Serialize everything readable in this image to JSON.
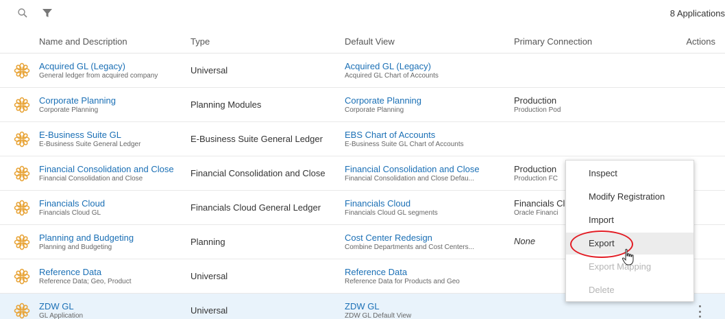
{
  "toolbar": {
    "app_count": "8 Applications",
    "icons": [
      "search-icon",
      "filter-icon"
    ]
  },
  "columns": {
    "name": "Name and Description",
    "type": "Type",
    "view": "Default View",
    "connection": "Primary Connection",
    "actions": "Actions"
  },
  "rows": [
    {
      "name": "Acquired GL (Legacy)",
      "desc": "General ledger from acquired company",
      "type": "Universal",
      "view": "Acquired GL (Legacy)",
      "view_desc": "Acquired GL Chart of Accounts",
      "conn": "",
      "conn_desc": ""
    },
    {
      "name": "Corporate Planning",
      "desc": "Corporate Planning",
      "type": "Planning Modules",
      "view": "Corporate Planning",
      "view_desc": "Corporate Planning",
      "conn": "Production",
      "conn_desc": "Production Pod"
    },
    {
      "name": "E-Business Suite GL",
      "desc": "E-Business Suite General Ledger",
      "type": "E-Business Suite General Ledger",
      "view": "EBS Chart of Accounts",
      "view_desc": "E-Business Suite GL Chart of Accounts",
      "conn": "",
      "conn_desc": ""
    },
    {
      "name": "Financial Consolidation and Close",
      "desc": "Financial Consolidation and Close",
      "type": "Financial Consolidation and Close",
      "view": "Financial Consolidation and Close",
      "view_desc": "Financial Consolidation and Close Defau...",
      "conn": "Production",
      "conn_desc": "Production FC"
    },
    {
      "name": "Financials Cloud",
      "desc": "Financials Cloud GL",
      "type": "Financials Cloud General Ledger",
      "view": "Financials Cloud",
      "view_desc": "Financials Cloud GL segments",
      "conn": "Financials Cl",
      "conn_desc": "Oracle Financi"
    },
    {
      "name": "Planning and Budgeting",
      "desc": "Planning and Budgeting",
      "type": "Planning",
      "view": "Cost Center Redesign",
      "view_desc": "Combine Departments and Cost Centers...",
      "conn": "None",
      "conn_desc": ""
    },
    {
      "name": "Reference Data",
      "desc": "Reference Data; Geo, Product",
      "type": "Universal",
      "view": "Reference Data",
      "view_desc": "Reference Data for Products and Geo",
      "conn": "",
      "conn_desc": ""
    },
    {
      "name": "ZDW GL",
      "desc": "GL Application",
      "type": "Universal",
      "view": "ZDW GL",
      "view_desc": "ZDW GL Default View",
      "conn": "",
      "conn_desc": ""
    }
  ],
  "menu": {
    "inspect": "Inspect",
    "modify": "Modify Registration",
    "import": "Import",
    "export": "Export",
    "export_mapping": "Export Mapping",
    "delete": "Delete"
  },
  "colors": {
    "link": "#1a6fb5",
    "app_icon": "#e8a53a",
    "selected_row": "#e9f3fb",
    "annotation": "#e21b23"
  }
}
